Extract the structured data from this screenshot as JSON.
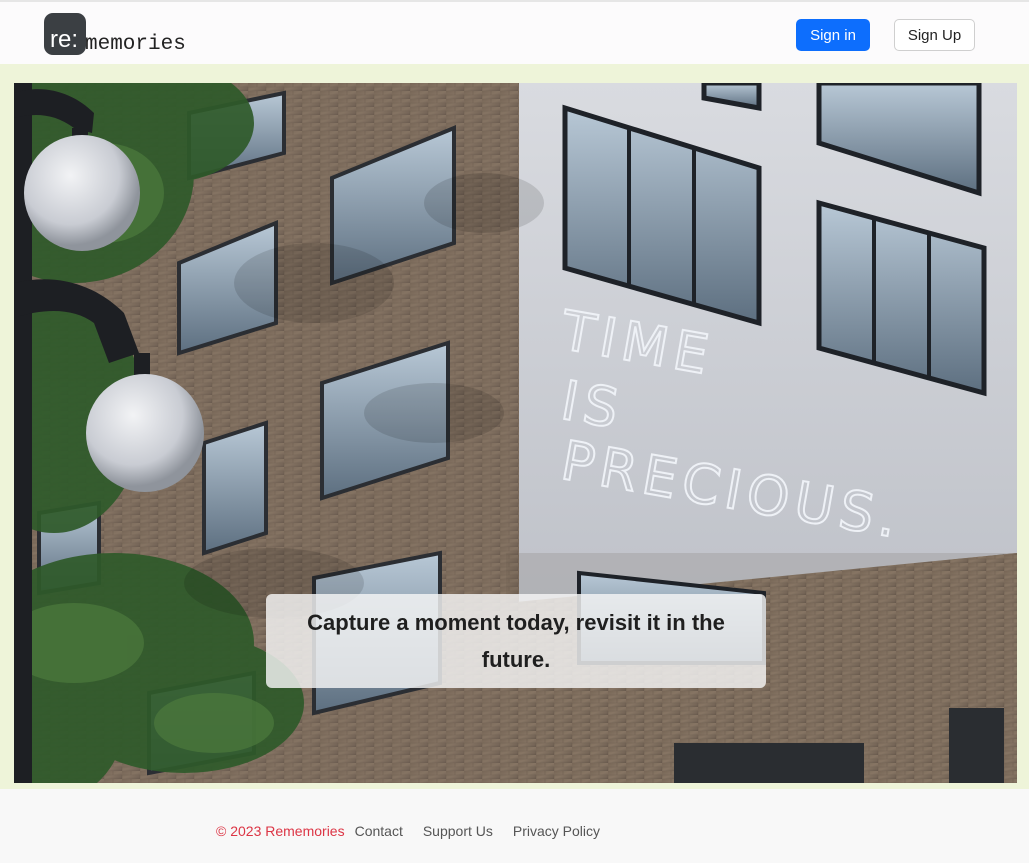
{
  "header": {
    "logo_badge": "re:",
    "logo_text": "memories",
    "signin_label": "Sign in",
    "signup_label": "Sign Up"
  },
  "hero": {
    "tagline": "Capture a moment today, revisit it in the future.",
    "neon_sign": [
      "TIME",
      "IS",
      "PRECIOUS."
    ]
  },
  "footer": {
    "copyright": "© 2023 Rememories",
    "links": [
      "Contact",
      "Support Us",
      "Privacy Policy"
    ]
  },
  "colors": {
    "primary": "#0d6efd",
    "copyright": "#dc3545",
    "hero_frame": "#eef4d9"
  }
}
